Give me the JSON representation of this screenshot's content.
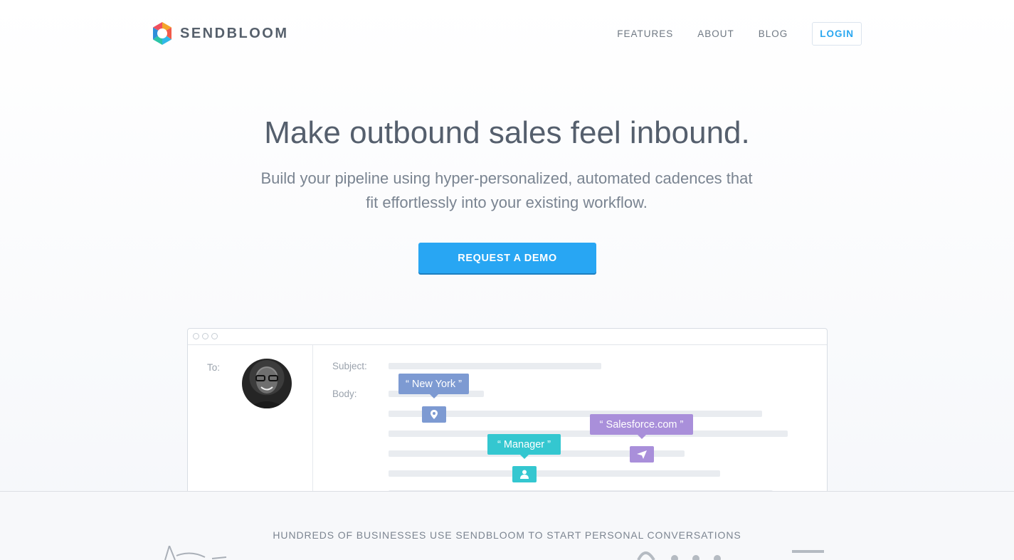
{
  "brand": {
    "name": "SENDBLOOM",
    "colors": {
      "accent": "#28a6f3",
      "login": "#2aa7f0",
      "text": "#555f6d"
    }
  },
  "nav": {
    "links": [
      "FEATURES",
      "ABOUT",
      "BLOG"
    ],
    "login_label": "LOGIN"
  },
  "hero": {
    "title": "Make outbound sales feel inbound.",
    "subtitle": "Build your pipeline using hyper-personalized, automated cadences that fit effortlessly into your existing workflow.",
    "cta_label": "REQUEST A DEMO"
  },
  "mockup": {
    "to_label": "To:",
    "subject_label": "Subject:",
    "body_label": "Body:",
    "tags": {
      "location": {
        "text": "“ New York ”",
        "color": "#7d9ad2",
        "icon": "map-pin-icon"
      },
      "title": {
        "text": "“ Manager ”",
        "color": "#34c7d0",
        "icon": "person-icon"
      },
      "company": {
        "text": "“ Salesforce.com ”",
        "color": "#a98fda",
        "icon": "send-icon"
      }
    }
  },
  "social_proof": {
    "heading": "HUNDREDS OF BUSINESSES USE SENDBLOOM TO START PERSONAL CONVERSATIONS"
  }
}
